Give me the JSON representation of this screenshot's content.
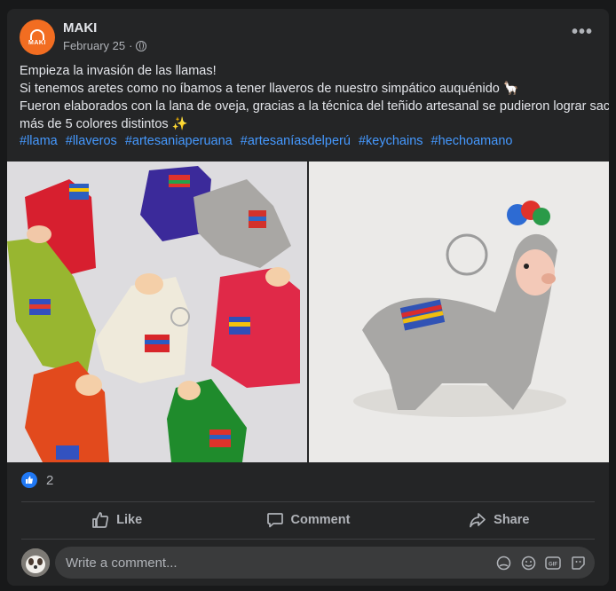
{
  "post": {
    "author": "MAKI",
    "avatar_text": "MAKI",
    "date": "February 25",
    "separator": "·",
    "more_label": "•••",
    "lines": [
      "Empieza la invasión de las llamas!",
      "Si tenemos aretes como no íbamos a tener llaveros de nuestro simpático auquénido 🦙",
      "Fueron elaborados con la lana de oveja, gracias a la técnica del teñido artesanal se pudieron lograr sacar",
      "más de 5 colores distintos ✨"
    ],
    "hashtags": [
      "#llama",
      "#llaveros",
      "#artesaniaperuana",
      "#artesaníasdelperú",
      "#keychains",
      "#hechoamano"
    ]
  },
  "reactions": {
    "count": "2"
  },
  "actions": {
    "like": "Like",
    "comment": "Comment",
    "share": "Share"
  },
  "comment": {
    "placeholder": "Write a comment..."
  },
  "colors": {
    "link": "#4599ff",
    "like_blue": "#2078f4",
    "brand_orange": "#f26d21"
  }
}
